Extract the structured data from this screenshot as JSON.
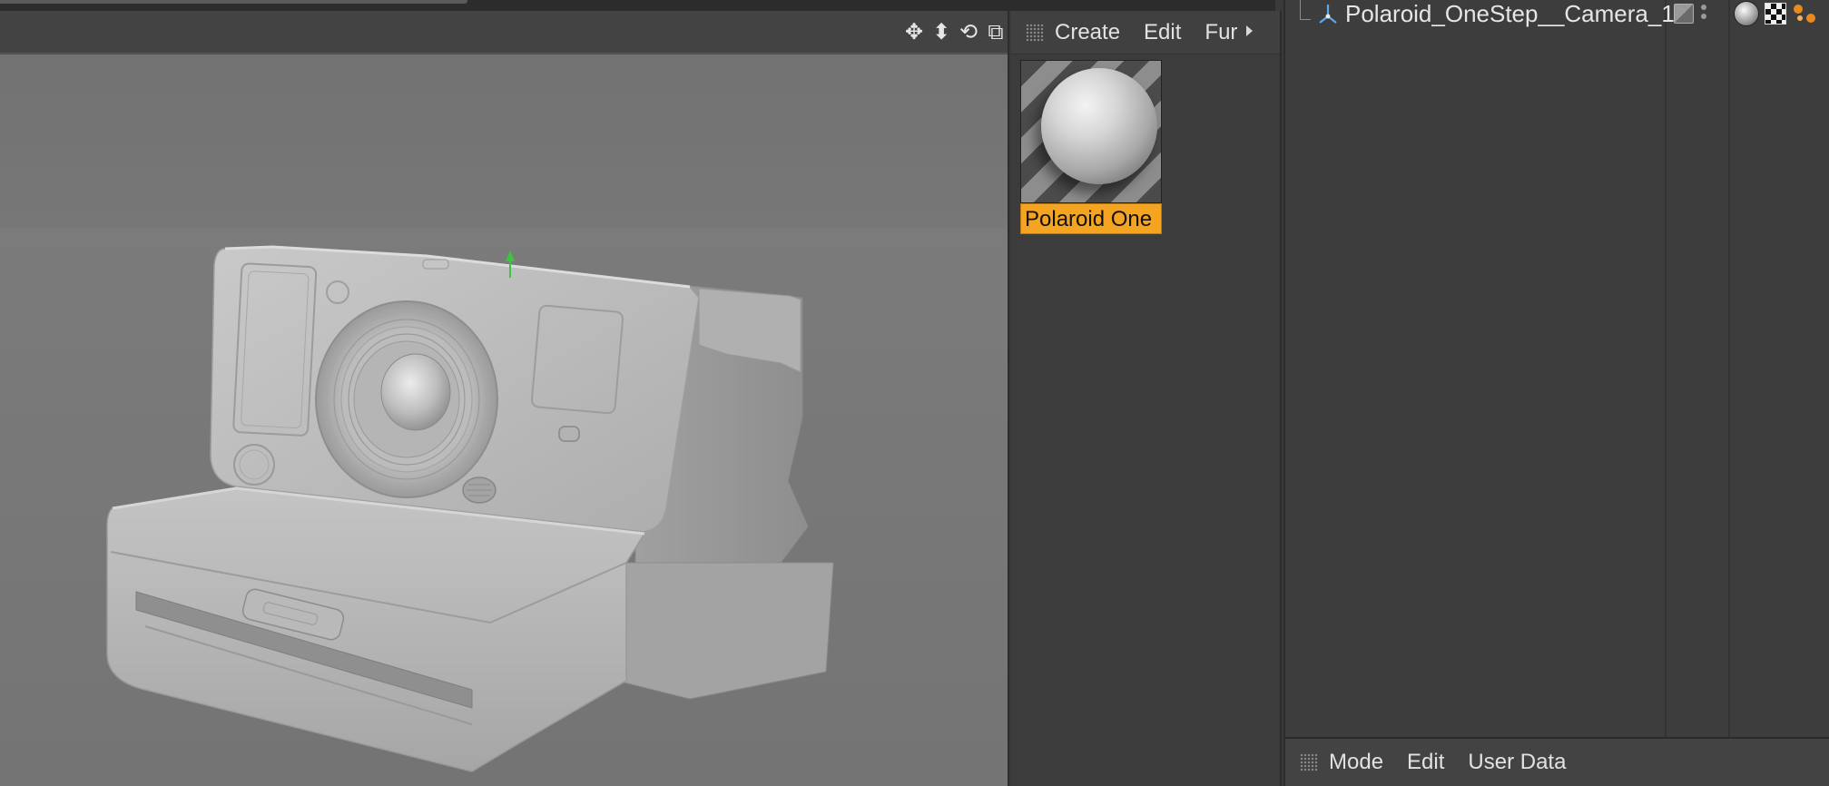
{
  "viewport": {
    "nav_icons": [
      "move-view-icon",
      "dolly-view-icon",
      "rotate-view-icon",
      "maximize-view-icon"
    ],
    "nav_glyphs": [
      "✥",
      "⬍",
      "⟲",
      "⧉"
    ]
  },
  "material_manager": {
    "menu": [
      "Create",
      "Edit",
      "Fur"
    ],
    "materials": [
      {
        "label": "Polaroid One",
        "selected": true,
        "highlight_color": "#f4a421"
      }
    ]
  },
  "object_manager": {
    "objects": [
      {
        "name": "Polaroid_OneStep__Camera_1",
        "icon": "null-object-icon"
      }
    ],
    "tags": [
      "material-tag-icon",
      "texture-tag-icon",
      "phong-tag-icon"
    ]
  },
  "attribute_manager": {
    "menu": [
      "Mode",
      "Edit",
      "User Data"
    ]
  },
  "colors": {
    "selection": "#f4a421",
    "panel_bg": "#3d3d3d",
    "viewport_bg": "#777777",
    "axis_y": "#3ec43e"
  }
}
